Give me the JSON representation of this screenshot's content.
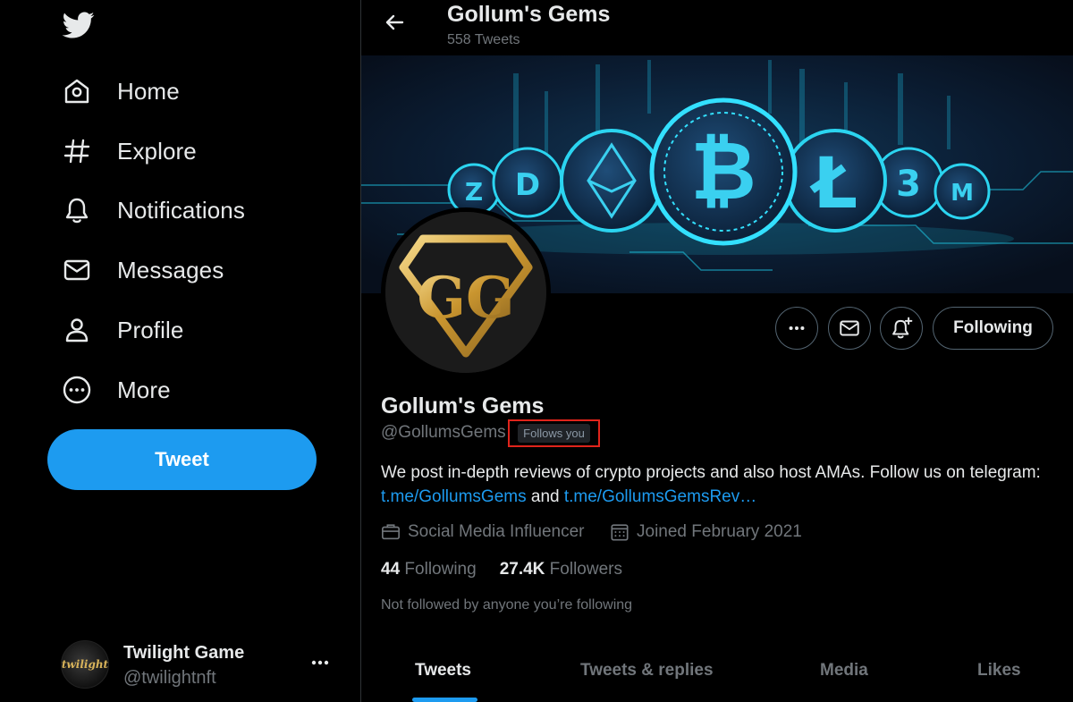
{
  "sidebar": {
    "logo_icon": "twitter-bird-icon",
    "items": [
      {
        "label": "Home",
        "icon": "home-icon"
      },
      {
        "label": "Explore",
        "icon": "hashtag-icon"
      },
      {
        "label": "Notifications",
        "icon": "bell-icon"
      },
      {
        "label": "Messages",
        "icon": "envelope-icon"
      },
      {
        "label": "Profile",
        "icon": "person-icon"
      },
      {
        "label": "More",
        "icon": "more-circle-icon"
      }
    ],
    "tweet_button": "Tweet",
    "account": {
      "name": "Twilight Game",
      "handle": "@twilightnft",
      "avatar_text": "twilight"
    }
  },
  "header": {
    "title": "Gollum's Gems",
    "subtitle": "558 Tweets"
  },
  "profile": {
    "name": "Gollum's Gems",
    "handle": "@GollumsGems",
    "follows_you": "Follows you",
    "bio_text": "We post in-depth reviews of crypto projects and also host AMAs.  Follow us on telegram: ",
    "bio_link1": "t.me/GollumsGems",
    "bio_and": " and ",
    "bio_link2": "t.me/GollumsGemsRev…",
    "category": "Social Media Influencer",
    "joined": "Joined February 2021",
    "following_count": "44",
    "following_label": "Following",
    "followers_count": "27.4K",
    "followers_label": "Followers",
    "not_followed_text": "Not followed by anyone you’re following",
    "follow_button": "Following",
    "avatar_text": "GG"
  },
  "tabs": [
    {
      "label": "Tweets",
      "active": true
    },
    {
      "label": "Tweets & replies",
      "active": false
    },
    {
      "label": "Media",
      "active": false
    },
    {
      "label": "Likes",
      "active": false
    }
  ],
  "colors": {
    "accent": "#1d9bf0",
    "background": "#000000",
    "badge_outline": "#e0241b",
    "gold": "#d8b35a"
  }
}
